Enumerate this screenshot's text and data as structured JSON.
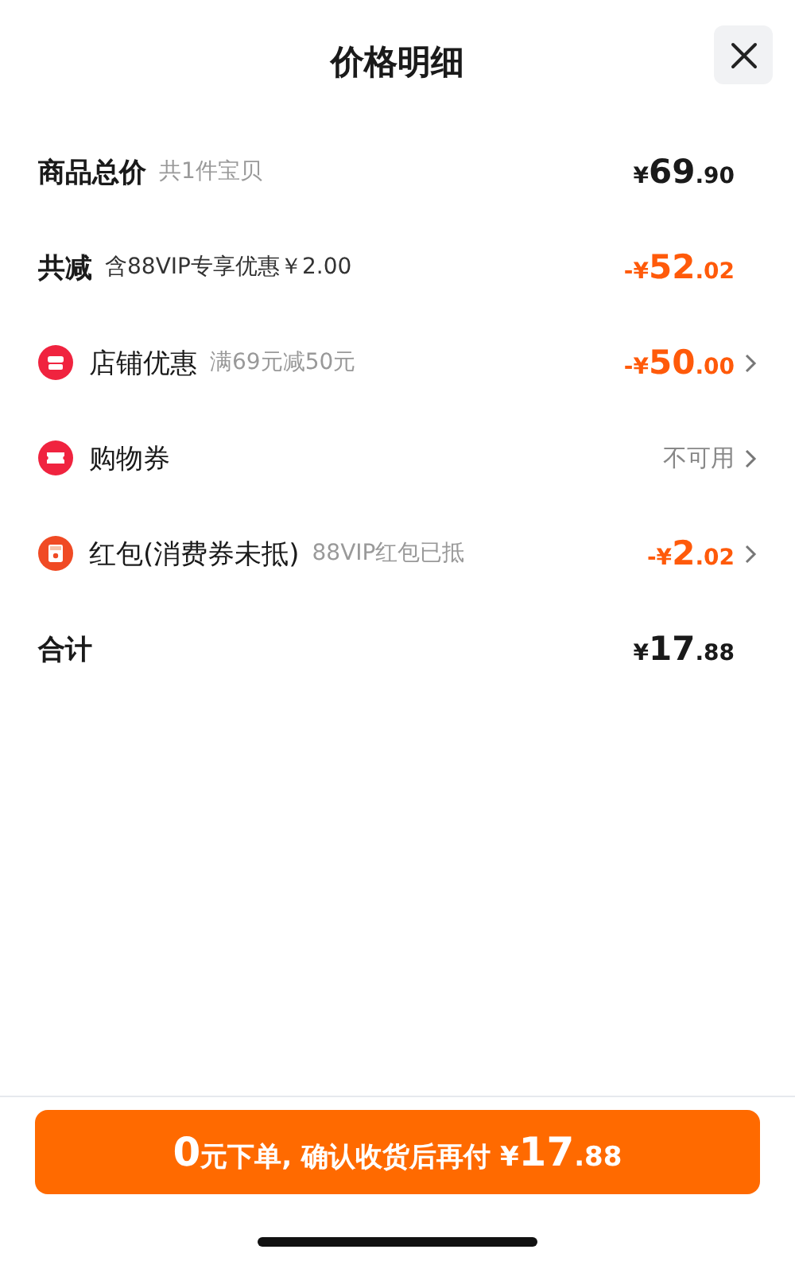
{
  "title": "价格明细",
  "rows": [
    {
      "kind": "subtotal",
      "label": "商品总价",
      "note": "共1件宝贝",
      "amount": {
        "currency": "¥",
        "whole": "69",
        "fraction": ".90"
      },
      "chevron": false
    },
    {
      "kind": "reduction",
      "label": "共减",
      "note": "含88VIP专享优惠￥2.00",
      "amount": {
        "currency": "-¥",
        "whole": "52",
        "fraction": ".02"
      },
      "chevron": false
    },
    {
      "kind": "store",
      "label": "店铺优惠",
      "note": "满69元减50元",
      "amount": {
        "currency": "-¥",
        "whole": "50",
        "fraction": ".00"
      },
      "chevron": true
    },
    {
      "kind": "coupon",
      "label": "购物券",
      "status": "不可用",
      "chevron": true
    },
    {
      "kind": "packet",
      "label": "红包(消费券未抵)",
      "note": "88VIP红包已抵",
      "amount": {
        "currency": "-¥",
        "whole": "2",
        "fraction": ".02"
      },
      "chevron": true
    },
    {
      "kind": "total",
      "label": "合计",
      "amount": {
        "currency": "¥",
        "whole": "17",
        "fraction": ".88"
      },
      "chevron": false
    }
  ],
  "button": {
    "lead": "0",
    "text": "元下单, 确认收货后再付 ¥",
    "whole": "17",
    "fraction": ".88"
  }
}
